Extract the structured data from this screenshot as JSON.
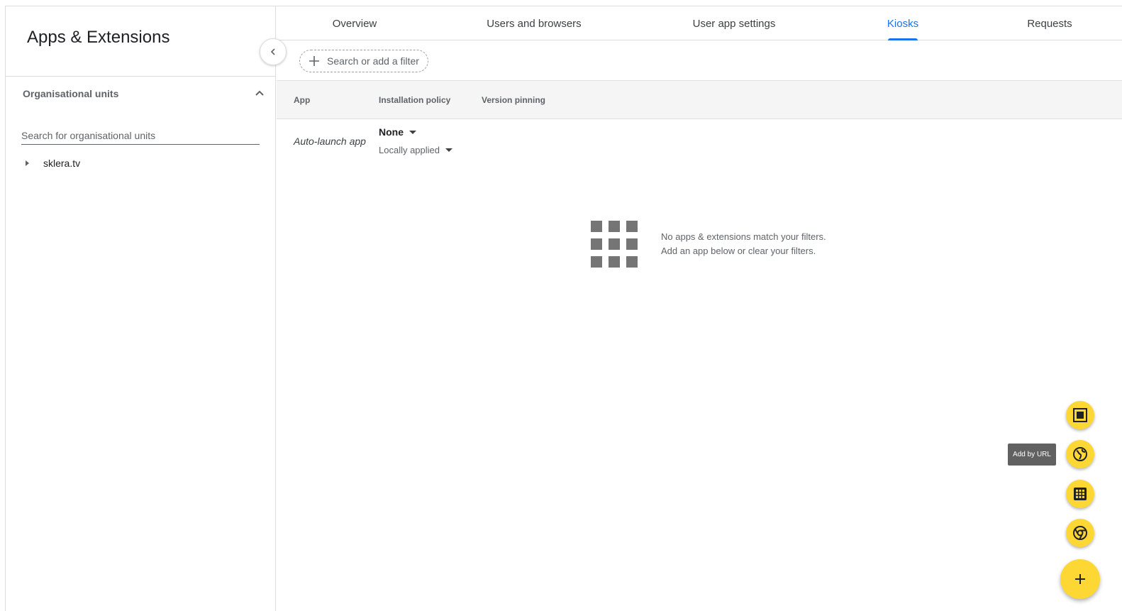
{
  "app": {
    "title": "Apps & Extensions"
  },
  "sidebar": {
    "org_units_header": "Organisational units",
    "search_placeholder": "Search for organisational units",
    "tree": [
      {
        "label": "sklera.tv"
      }
    ]
  },
  "tabs": [
    {
      "label": "Overview",
      "active": false
    },
    {
      "label": "Users and browsers",
      "active": false
    },
    {
      "label": "User app settings",
      "active": false
    },
    {
      "label": "Kiosks",
      "active": true
    },
    {
      "label": "Requests",
      "active": false
    }
  ],
  "filter": {
    "label": "Search or add a filter"
  },
  "table": {
    "columns": [
      "App",
      "Installation policy",
      "Version pinning"
    ],
    "auto_launch": {
      "label": "Auto-launch app",
      "policy_value": "None",
      "policy_source": "Locally applied"
    }
  },
  "empty_state": {
    "line1": "No apps & extensions match your filters.",
    "line2": "Add an app below or clear your filters."
  },
  "fab": {
    "tooltip": "Add by URL",
    "actions": [
      {
        "icon": "kiosk-app-icon"
      },
      {
        "icon": "globe-icon"
      },
      {
        "icon": "apps-grid-icon"
      },
      {
        "icon": "chrome-icon"
      }
    ],
    "main_icon": "plus-icon"
  },
  "colors": {
    "accent": "#1a73e8",
    "fab": "#fdd835"
  }
}
